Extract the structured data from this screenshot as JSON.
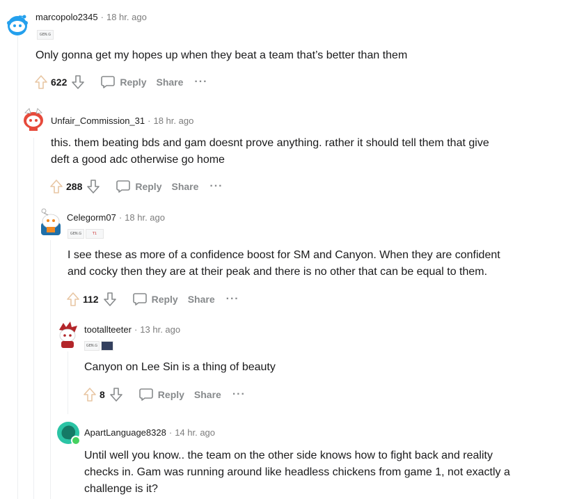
{
  "comments": [
    {
      "user": "marcopolo2345",
      "time": "18 hr. ago",
      "text": [
        "Only gonna get my hopes up when they beat a team that’s better than them"
      ],
      "score": "622",
      "reply": "Reply",
      "share": "Share",
      "more": "···"
    },
    {
      "user": "Unfair_Commission_31",
      "time": "18 hr. ago",
      "text": [
        "this. them beating bds and gam doesnt prove anything. rather it should tell them that give",
        "deft a good adc otherwise go home"
      ],
      "score": "288",
      "reply": "Reply",
      "share": "Share",
      "more": "···"
    },
    {
      "user": "Celegorm07",
      "time": "18 hr. ago",
      "text": [
        "I see these as more of a confidence boost for SM and Canyon. When they are confident",
        "and cocky then they are at their peak and there is no other that can be equal to them."
      ],
      "score": "112",
      "reply": "Reply",
      "share": "Share",
      "more": "···"
    },
    {
      "user": "tootallteeter",
      "time": "13 hr. ago",
      "text": [
        "Canyon on Lee Sin is a thing of beauty"
      ],
      "score": "8",
      "reply": "Reply",
      "share": "Share",
      "more": "···"
    },
    {
      "user": "ApartLanguage8328",
      "time": "14 hr. ago",
      "text": [
        "Until well you know.. the team on the other side knows how to fight back and reality",
        "checks in. Gam was running around like headless chickens from game 1, not exactly a",
        "challenge is it?"
      ]
    }
  ],
  "colors": {
    "upvote": "#e8c6a3",
    "meta": "#7c7c7c",
    "online": "#46d160",
    "snoo_blue": "#24a0ed"
  },
  "icons": [
    "upvote-icon",
    "downvote-icon",
    "comment-bubble-icon",
    "more-options-icon"
  ]
}
